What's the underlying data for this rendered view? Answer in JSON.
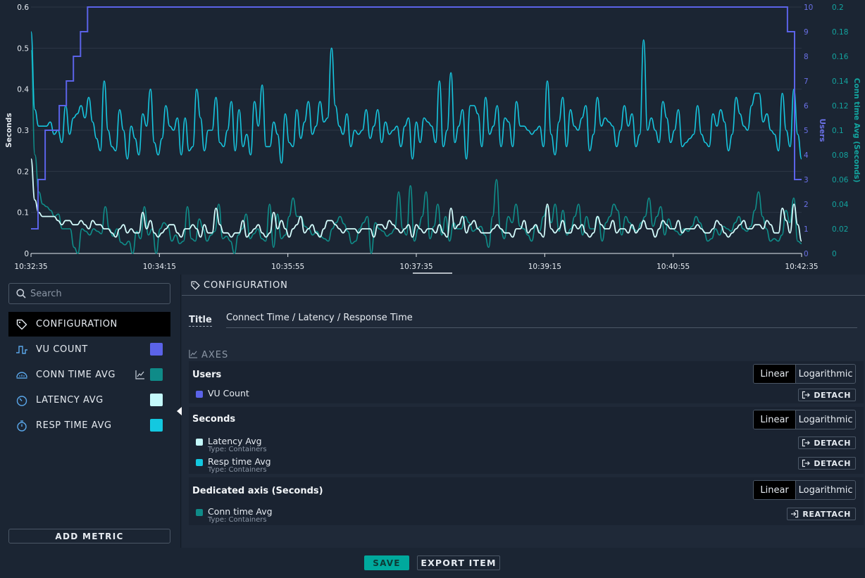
{
  "chart_data": {
    "type": "line",
    "x": [
      "10:32:35",
      "10:34:15",
      "10:35:55",
      "10:37:35",
      "10:39:15",
      "10:40:55",
      "10:42:35"
    ],
    "ylabel_left": "Seconds",
    "ylabel_users": "Users",
    "ylabel_dedicated": "Conn time Avg (Seconds)",
    "ylim_left": [
      0,
      0.6
    ],
    "ylim_users": [
      0,
      10
    ],
    "ylim_dedicated": [
      0,
      0.2
    ],
    "left_ticks": [
      "0",
      "0.1",
      "0.2",
      "0.3",
      "0.4",
      "0.5",
      "0.6"
    ],
    "users_ticks": [
      "0",
      "1",
      "2",
      "3",
      "4",
      "5",
      "6",
      "7",
      "8",
      "9",
      "10"
    ],
    "dedicated_ticks": [
      "0",
      "0.02",
      "0.04",
      "0.06",
      "0.08",
      "0.1",
      "0.12",
      "0.14",
      "0.16",
      "0.18",
      "0.2"
    ],
    "grid": true,
    "series": [
      {
        "key": "vu",
        "axis": "users",
        "color": "#5b63e8",
        "step": true,
        "points": [
          [
            0,
            1
          ],
          [
            10,
            1
          ],
          [
            10,
            3
          ],
          [
            20,
            3
          ],
          [
            20,
            5
          ],
          [
            30,
            5
          ],
          [
            30,
            5
          ],
          [
            40,
            5
          ],
          [
            40,
            6
          ],
          [
            50,
            6
          ],
          [
            50,
            7
          ],
          [
            60,
            7
          ],
          [
            60,
            8
          ],
          [
            70,
            8
          ],
          [
            70,
            9
          ],
          [
            80,
            9
          ],
          [
            80,
            10
          ],
          [
            90,
            10
          ],
          [
            1070,
            10
          ],
          [
            1070,
            9
          ],
          [
            1080,
            9
          ],
          [
            1080,
            3
          ],
          [
            1090,
            3
          ]
        ]
      },
      {
        "key": "resp",
        "axis": "left",
        "color": "#16c6df",
        "values": [
          0.54,
          0.35,
          0.31,
          0.31,
          0.31,
          0.32,
          0.29,
          0.3,
          0.27,
          0.36,
          0.29,
          0.33,
          0.34,
          0.36,
          0.33,
          0.38,
          0.32,
          0.28,
          0.25,
          0.42,
          0.3,
          0.26,
          0.25,
          0.35,
          0.3,
          0.23,
          0.31,
          0.28,
          0.24,
          0.34,
          0.31,
          0.4,
          0.27,
          0.24,
          0.28,
          0.36,
          0.31,
          0.3,
          0.33,
          0.24,
          0.33,
          0.25,
          0.26,
          0.4,
          0.33,
          0.25,
          0.3,
          0.3,
          0.38,
          0.27,
          0.26,
          0.3,
          0.37,
          0.25,
          0.35,
          0.26,
          0.29,
          0.24,
          0.37,
          0.31,
          0.41,
          0.26,
          0.26,
          0.32,
          0.29,
          0.22,
          0.34,
          0.27,
          0.26,
          0.35,
          0.28,
          0.32,
          0.37,
          0.29,
          0.31,
          0.37,
          0.32,
          0.33,
          0.5,
          0.36,
          0.31,
          0.29,
          0.34,
          0.26,
          0.3,
          0.29,
          0.3,
          0.35,
          0.28,
          0.31,
          0.35,
          0.27,
          0.32,
          0.29,
          0.3,
          0.31,
          0.26,
          0.31,
          0.33,
          0.23,
          0.32,
          0.27,
          0.33,
          0.32,
          0.31,
          0.27,
          0.42,
          0.26,
          0.3,
          0.44,
          0.27,
          0.31,
          0.35,
          0.23,
          0.36,
          0.36,
          0.34,
          0.26,
          0.38,
          0.29,
          0.31,
          0.36,
          0.26,
          0.33,
          0.32,
          0.26,
          0.37,
          0.31,
          0.31,
          0.3,
          0.29,
          0.3,
          0.31,
          0.26,
          0.42,
          0.29,
          0.24,
          0.32,
          0.38,
          0.26,
          0.35,
          0.31,
          0.3,
          0.33,
          0.36,
          0.25,
          0.29,
          0.38,
          0.31,
          0.33,
          0.32,
          0.31,
          0.26,
          0.3,
          0.36,
          0.31,
          0.34,
          0.26,
          0.29,
          0.52,
          0.3,
          0.33,
          0.3,
          0.27,
          0.37,
          0.33,
          0.27,
          0.3,
          0.35,
          0.26,
          0.27,
          0.28,
          0.29,
          0.36,
          0.29,
          0.27,
          0.26,
          0.34,
          0.31,
          0.35,
          0.32,
          0.25,
          0.29,
          0.38,
          0.34,
          0.31,
          0.3,
          0.36,
          0.39,
          0.39,
          0.32,
          0.34,
          0.3,
          0.29,
          0.25,
          0.39,
          0.3,
          0.26,
          0.4,
          0.29,
          0.23
        ]
      },
      {
        "key": "latency",
        "axis": "left",
        "color": "#d4fcfc",
        "values": [
          0.23,
          0.13,
          0.1,
          0.09,
          0.09,
          0.09,
          0.09,
          0.08,
          0.07,
          0.08,
          0.08,
          0.07,
          0.07,
          0.08,
          0.07,
          0.06,
          0.08,
          0.07,
          0.07,
          0.06,
          0.06,
          0.05,
          0.04,
          0.06,
          0.07,
          0.05,
          0.06,
          0.05,
          0.05,
          0.1,
          0.06,
          0.08,
          0.05,
          0.04,
          0.05,
          0.06,
          0.07,
          0.07,
          0.05,
          0.04,
          0.06,
          0.06,
          0.07,
          0.06,
          0.04,
          0.07,
          0.05,
          0.05,
          0.11,
          0.07,
          0.05,
          0.05,
          0.04,
          0.05,
          0.05,
          0.08,
          0.04,
          0.05,
          0.06,
          0.07,
          0.05,
          0.04,
          0.05,
          0.1,
          0.06,
          0.08,
          0.06,
          0.04,
          0.06,
          0.07,
          0.09,
          0.05,
          0.06,
          0.07,
          0.05,
          0.04,
          0.06,
          0.08,
          0.08,
          0.07,
          0.06,
          0.05,
          0.06,
          0.06,
          0.06,
          0.05,
          0.06,
          0.06,
          0.06,
          0.04,
          0.07,
          0.07,
          0.06,
          0.08,
          0.07,
          0.06,
          0.05,
          0.06,
          0.07,
          0.04,
          0.07,
          0.06,
          0.05,
          0.06,
          0.06,
          0.05,
          0.07,
          0.05,
          0.04,
          0.11,
          0.06,
          0.07,
          0.09,
          0.05,
          0.07,
          0.08,
          0.06,
          0.05,
          0.05,
          0.05,
          0.06,
          0.07,
          0.06,
          0.05,
          0.05,
          0.04,
          0.06,
          0.06,
          0.08,
          0.05,
          0.06,
          0.07,
          0.05,
          0.04,
          0.12,
          0.06,
          0.05,
          0.06,
          0.08,
          0.05,
          0.05,
          0.07,
          0.06,
          0.07,
          0.05,
          0.04,
          0.05,
          0.09,
          0.07,
          0.06,
          0.06,
          0.08,
          0.05,
          0.06,
          0.06,
          0.05,
          0.07,
          0.05,
          0.06,
          0.08,
          0.06,
          0.06,
          0.04,
          0.06,
          0.08,
          0.07,
          0.06,
          0.06,
          0.08,
          0.05,
          0.06,
          0.06,
          0.06,
          0.07,
          0.06,
          0.05,
          0.05,
          0.06,
          0.08,
          0.07,
          0.05,
          0.04,
          0.05,
          0.06,
          0.07,
          0.08,
          0.06,
          0.06,
          0.07,
          0.07,
          0.06,
          0.08,
          0.07,
          0.05,
          0.05,
          0.11,
          0.08,
          0.05,
          0.12,
          0.07,
          0.03
        ]
      },
      {
        "key": "conn",
        "axis": "dedicated",
        "color": "#0f8f8b",
        "values": [
          0.165,
          0.08,
          0.05,
          0.04,
          0.038,
          0.035,
          0.03,
          0.032,
          0.02,
          0.02,
          0.02,
          0.005,
          0.0,
          0.02,
          0.018,
          0.015,
          0.02,
          0.018,
          0.016,
          0.038,
          0.02,
          0.014,
          0.02,
          0.009,
          0.007,
          0.01,
          0.0,
          0.018,
          0.012,
          0.038,
          0.015,
          0.02,
          0.0,
          0.02,
          0.025,
          0.022,
          0.01,
          0.015,
          0.008,
          0.01,
          0.038,
          0.012,
          0.01,
          0.028,
          0.02,
          0.01,
          0.015,
          0.018,
          0.04,
          0.012,
          0.014,
          0.01,
          0.0,
          0.015,
          0.02,
          0.032,
          0.012,
          0.016,
          0.02,
          0.012,
          0.01,
          0.04,
          0.005,
          0.032,
          0.012,
          0.015,
          0.03,
          0.045,
          0.03,
          0.03,
          0.022,
          0.02,
          0.015,
          0.018,
          0.014,
          0.012,
          0.01,
          0.02,
          0.025,
          0.03,
          0.024,
          0.018,
          0.008,
          0.01,
          0.02,
          0.025,
          0.03,
          0.0,
          0.025,
          0.02,
          0.018,
          0.014,
          0.016,
          0.02,
          0.05,
          0.02,
          0.015,
          0.055,
          0.01,
          0.02,
          0.03,
          0.05,
          0.012,
          0.022,
          0.04,
          0.015,
          0.03,
          0.01,
          0.025,
          0.02,
          0.02,
          0.03,
          0.025,
          0.018,
          0.02,
          0.022,
          0.015,
          0.005,
          0.03,
          0.06,
          0.02,
          0.012,
          0.03,
          0.025,
          0.04,
          0.022,
          0.02,
          0.015,
          0.01,
          0.022,
          0.018,
          0.03,
          0.038,
          0.025,
          0.04,
          0.018,
          0.035,
          0.015,
          0.02,
          0.03,
          0.04,
          0.015,
          0.03,
          0.02,
          0.02,
          0.03,
          0.01,
          0.025,
          0.03,
          0.04,
          0.035,
          0.015,
          0.03,
          0.025,
          0.02,
          0.018,
          0.025,
          0.03,
          0.045,
          0.022,
          0.03,
          0.038,
          0.015,
          0.028,
          0.02,
          0.018,
          0.015,
          0.02,
          0.018,
          0.022,
          0.03,
          0.025,
          0.018,
          0.01,
          0.012,
          0.02,
          0.015,
          0.022,
          0.02,
          0.018,
          0.025,
          0.03,
          0.02,
          0.018,
          0.022,
          0.035,
          0.05,
          0.03,
          0.02,
          0.01,
          0.012,
          0.01,
          0.015,
          0.035,
          0.025,
          0.045,
          0.01,
          0.008
        ]
      }
    ]
  },
  "search": {
    "placeholder": "Search"
  },
  "sidebar": {
    "items": [
      {
        "label": "CONFIGURATION",
        "icon": "tag-icon"
      },
      {
        "label": "VU COUNT",
        "icon": "step-wave-icon",
        "color": "#5b63e8"
      },
      {
        "label": "CONN TIME AVG",
        "icon": "gauge-icon",
        "color": "#0f8b88"
      },
      {
        "label": "LATENCY AVG",
        "icon": "timer-icon",
        "color": "#c4f9fb"
      },
      {
        "label": "RESP TIME AVG",
        "icon": "stopwatch-icon",
        "color": "#13c8e0"
      }
    ],
    "add_metric": "ADD METRIC"
  },
  "config": {
    "heading": "CONFIGURATION",
    "title_label": "Title",
    "title_value": "Connect Time / Latency / Response Time",
    "axes_heading": "AXES",
    "groups": [
      {
        "name": "Users",
        "scale_options": [
          "Linear",
          "Logarithmic"
        ],
        "metrics": [
          {
            "name": "VU Count",
            "type": "",
            "color": "#5b63e8",
            "action": "DETACH"
          }
        ]
      },
      {
        "name": "Seconds",
        "scale_options": [
          "Linear",
          "Logarithmic"
        ],
        "metrics": [
          {
            "name": "Latency Avg",
            "type": "Type: Containers",
            "color": "#c4f9fb",
            "action": "DETACH"
          },
          {
            "name": "Resp time Avg",
            "type": "Type: Containers",
            "color": "#13c8e0",
            "action": "DETACH"
          }
        ]
      },
      {
        "name": "Dedicated axis (Seconds)",
        "scale_options": [
          "Linear",
          "Logarithmic"
        ],
        "metrics": [
          {
            "name": "Conn time Avg",
            "type": "Type: Containers",
            "color": "#0f8b88",
            "action": "REATTACH"
          }
        ]
      }
    ]
  },
  "footer": {
    "save": "SAVE",
    "export": "EXPORT ITEM"
  }
}
